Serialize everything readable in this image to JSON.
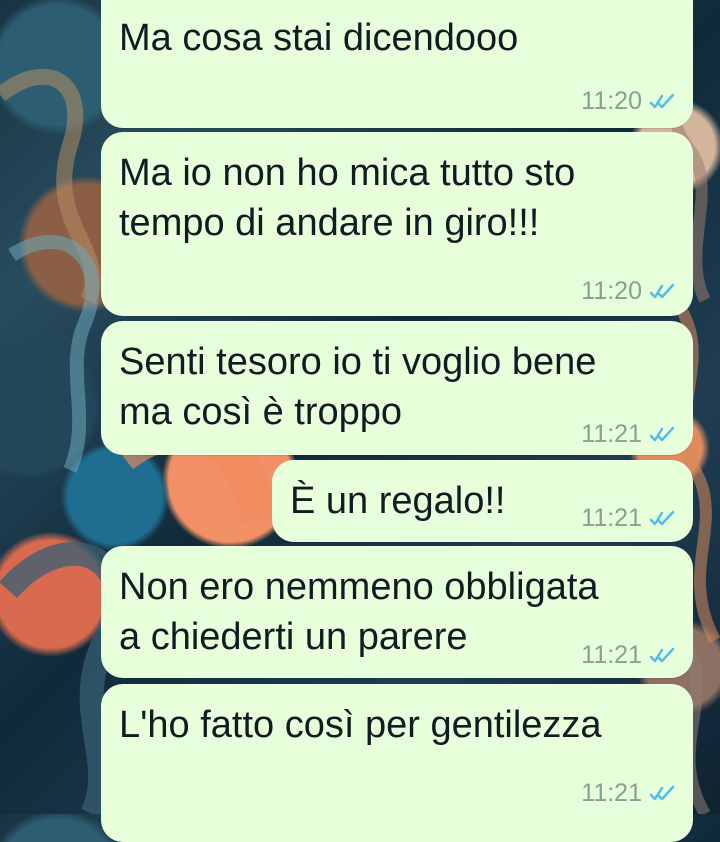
{
  "chat": {
    "messages": [
      {
        "text": "Ma cosa stai dicendooo",
        "time": "11:20",
        "status_icon": "double-check-icon"
      },
      {
        "text": "Ma io non ho mica tutto sto\ntempo di andare in giro!!!",
        "time": "11:20",
        "status_icon": "double-check-icon"
      },
      {
        "text": "Senti tesoro io ti voglio bene\nma così è troppo",
        "time": "11:21",
        "status_icon": "double-check-icon"
      },
      {
        "text": "È un regalo!!",
        "time": "11:21",
        "status_icon": "double-check-icon"
      },
      {
        "text": "Non ero nemmeno obbligata\na chiederti un parere",
        "time": "11:21",
        "status_icon": "double-check-icon"
      },
      {
        "text": "L'ho fatto così per gentilezza",
        "time": "11:21",
        "status_icon": "double-check-icon"
      }
    ]
  },
  "colors": {
    "bubble": "#e7ffdb",
    "text": "#111b21",
    "time": "#8aa08f",
    "read_ticks": "#53bdeb"
  }
}
